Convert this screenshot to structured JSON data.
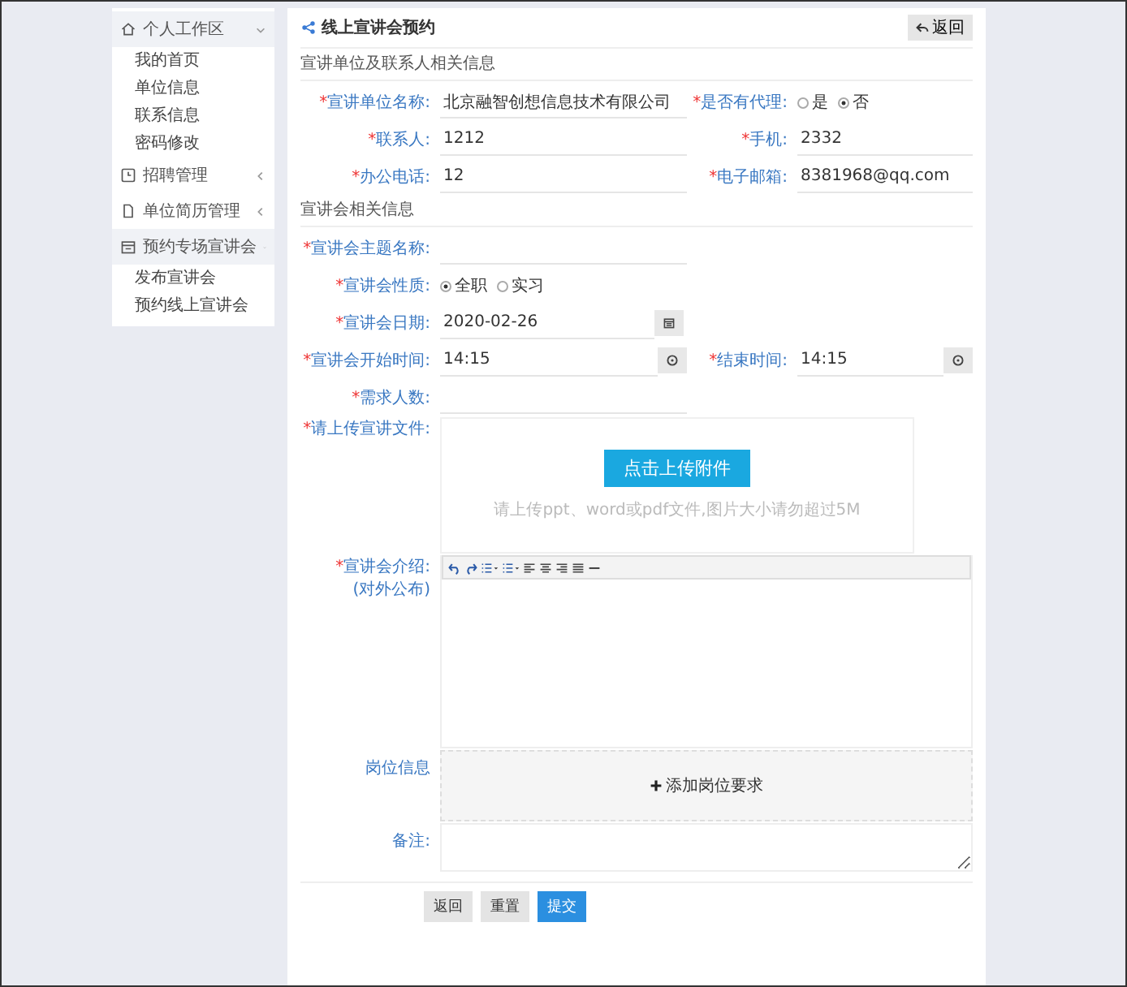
{
  "sidebar": {
    "groups": [
      {
        "label": "个人工作区",
        "expanded": true,
        "children": [
          {
            "label": "我的首页"
          },
          {
            "label": "单位信息"
          },
          {
            "label": "联系信息"
          },
          {
            "label": "密码修改"
          }
        ]
      },
      {
        "label": "招聘管理",
        "expanded": false
      },
      {
        "label": "单位简历管理",
        "expanded": false
      },
      {
        "label": "预约专场宣讲会",
        "expanded": true,
        "children": [
          {
            "label": "发布宣讲会"
          },
          {
            "label": "预约线上宣讲会"
          }
        ]
      }
    ]
  },
  "panel": {
    "title": "线上宣讲会预约",
    "back_button": "返回"
  },
  "sections": [
    {
      "heading": "宣讲单位及联系人相关信息",
      "rows": [
        [
          {
            "kind": "text",
            "mark": "*",
            "label": "宣讲单位名称:",
            "value": "北京融智创想信息技术有限公司"
          },
          {
            "kind": "radio",
            "mark": "*",
            "label": "是否有代理:",
            "options": [
              {
                "label": "是",
                "selected": false
              },
              {
                "label": "否",
                "selected": true
              }
            ]
          }
        ],
        [
          {
            "kind": "text",
            "mark": "*",
            "label": "联系人:",
            "value": "1212"
          },
          {
            "kind": "text",
            "mark": "*",
            "label": "手机:",
            "value": "2332"
          }
        ],
        [
          {
            "kind": "text",
            "mark": "*",
            "label": "办公电话:",
            "value": "12"
          },
          {
            "kind": "text",
            "mark": "*",
            "label": "电子邮箱:",
            "value": "8381968@qq.com"
          }
        ]
      ]
    },
    {
      "heading": "宣讲会相关信息",
      "rows": [
        [
          {
            "kind": "text",
            "mark": "*",
            "label": "宣讲会主题名称:"
          }
        ],
        [
          {
            "kind": "radio",
            "mark": "*",
            "label": "宣讲会性质:",
            "options": [
              {
                "label": "全职",
                "selected": true
              },
              {
                "label": "实习",
                "selected": false
              }
            ]
          }
        ],
        [
          {
            "kind": "date",
            "mark": "*",
            "label": "宣讲会日期:",
            "value": "2020-02-26"
          }
        ],
        [
          {
            "kind": "time",
            "mark": "*",
            "label": "宣讲会开始时间:",
            "value": "14:15"
          },
          {
            "kind": "time",
            "mark": "*",
            "label": "结束时间:",
            "value": "14:15"
          }
        ],
        [
          {
            "kind": "text",
            "mark": "*",
            "label": "需求人数:"
          }
        ],
        [
          {
            "kind": "upload",
            "mark": "*",
            "label": "请上传宣讲文件:",
            "button": "点击上传附件",
            "hint": "请上传ppt、word或pdf文件,图片大小请勿超过5M"
          }
        ],
        [
          {
            "kind": "editor",
            "mark": "*",
            "label": "宣讲会介绍:",
            "sublabel": "(对外公布)"
          }
        ],
        [
          {
            "kind": "add",
            "label": "岗位信息",
            "button": "添加岗位要求"
          }
        ],
        [
          {
            "kind": "textarea",
            "label": "备注:"
          }
        ]
      ]
    }
  ],
  "footer_buttons": [
    {
      "label": "返回",
      "kind": "default"
    },
    {
      "label": "重置",
      "kind": "default"
    },
    {
      "label": "提交",
      "kind": "primary"
    }
  ]
}
